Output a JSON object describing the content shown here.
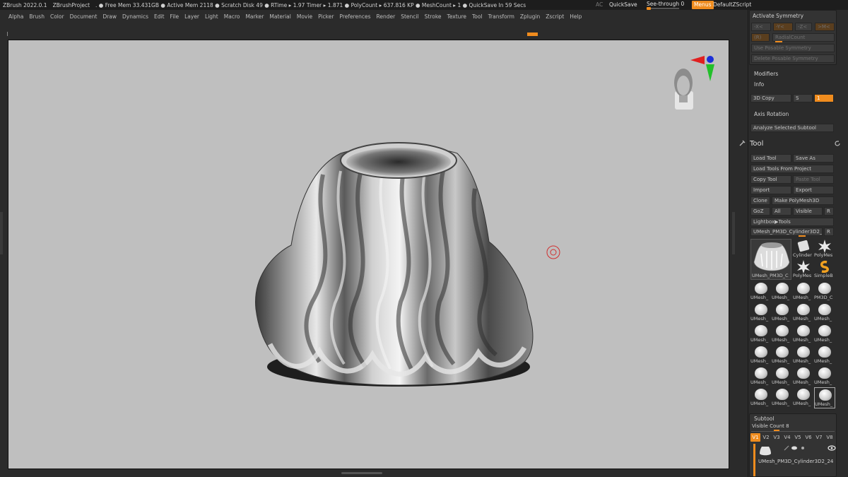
{
  "titlebar": {
    "app": "ZBrush 2022.0.1",
    "project": "ZBrushProject",
    "stats": ". ● Free Mem 33.431GB ● Active Mem 2118 ● Scratch Disk 49 ● RTime ▸ 1.97 Timer ▸ 1.871 ● PolyCount ▸ 637.816 KP ● MeshCount ▸ 1 ● QuickSave In 59 Secs",
    "ac": "AC",
    "quicksave": "QuickSave",
    "see_through": "See-through  0",
    "menus": "Menus",
    "default_zscript": "DefaultZScript"
  },
  "menubar": [
    "Alpha",
    "Brush",
    "Color",
    "Document",
    "Draw",
    "Dynamics",
    "Edit",
    "File",
    "Layer",
    "Light",
    "Macro",
    "Marker",
    "Material",
    "Movie",
    "Picker",
    "Preferences",
    "Render",
    "Stencil",
    "Stroke",
    "Texture",
    "Tool",
    "Transform",
    "Zplugin",
    "Zscript",
    "Help"
  ],
  "panel": {
    "activate_symmetry": "Activate Symmetry",
    "sym_x": "-X<",
    "sym_y": "-Y<",
    "sym_z": "-Z<",
    "sym_m": ">M<",
    "sym_r": "(R)",
    "radial_count": "RadialCount",
    "use_posable": "Use Posable Symmetry",
    "delete_posable": "Delete Posable Symmetry",
    "modifiers": "Modifiers",
    "info": "Info",
    "copy_3d": "3D Copy",
    "copy_s": "S",
    "copy_val": "1",
    "axis_rotation": "Axis Rotation",
    "analyze_subtool": "Analyze Selected Subtool",
    "tool_title": "Tool",
    "load_tool": "Load Tool",
    "save_as": "Save As",
    "load_from_project": "Load Tools From Project",
    "copy_tool": "Copy Tool",
    "paste_tool": "Paste Tool",
    "import": "Import",
    "export": "Export",
    "clone": "Clone",
    "make_polymesh": "Make PolyMesh3D",
    "goz": "GoZ",
    "all": "All",
    "visible": "Visible",
    "r": "R",
    "lightbox_tools": "Lightbox▶Tools",
    "current_tool": "UMesh_PM3D_Cylinder3D2_2",
    "current_r": "R",
    "big_thumb_label": "UMesh_PM3D_C",
    "tool_thumbs": [
      "Cylinder",
      "PolyMes",
      "PolyMes",
      "SimpleB"
    ],
    "grid_labels": [
      [
        "UMesh_",
        "UMesh_",
        "UMesh_",
        "PM3D_C"
      ],
      [
        "UMesh_",
        "UMesh_",
        "UMesh_",
        "UMesh_"
      ],
      [
        "UMesh_",
        "UMesh_",
        "UMesh_",
        "UMesh_"
      ],
      [
        "UMesh_",
        "UMesh_",
        "UMesh_",
        "UMesh_"
      ],
      [
        "UMesh_",
        "UMesh_",
        "UMesh_",
        "UMesh_"
      ],
      [
        "UMesh_",
        "UMesh_",
        "UMesh_",
        "UMesh_"
      ]
    ],
    "subtool_title": "Subtool",
    "visible_count": "Visible Count 8",
    "vtabs": [
      "V1",
      "V2",
      "V3",
      "V4",
      "V5",
      "V6",
      "V7",
      "V8"
    ],
    "subtool_name": "UMesh_PM3D_Cylinder3D2_24"
  }
}
